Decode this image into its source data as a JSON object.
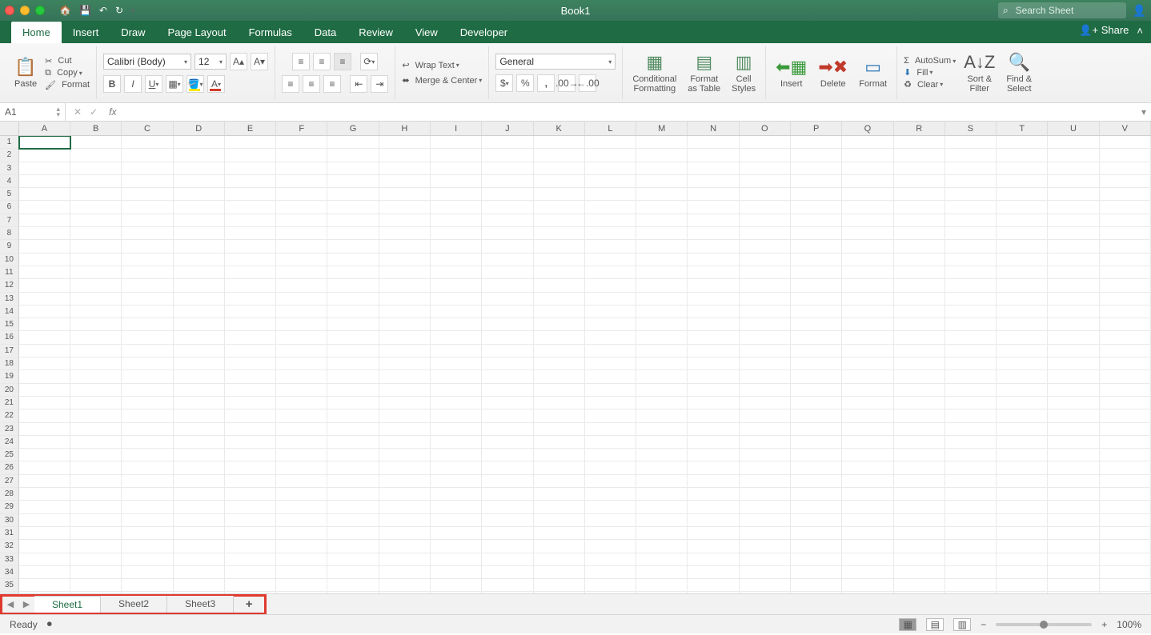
{
  "titlebar": {
    "title": "Book1",
    "search_placeholder": "Search Sheet"
  },
  "tabs": {
    "items": [
      "Home",
      "Insert",
      "Draw",
      "Page Layout",
      "Formulas",
      "Data",
      "Review",
      "View",
      "Developer"
    ],
    "active": "Home",
    "share_label": "Share"
  },
  "ribbon": {
    "paste_label": "Paste",
    "cut_label": "Cut",
    "copy_label": "Copy",
    "format_label": "Format",
    "font_name": "Calibri (Body)",
    "font_size": "12",
    "wrap_label": "Wrap Text",
    "merge_label": "Merge & Center",
    "number_format": "General",
    "cond_fmt_label": "Conditional\nFormatting",
    "table_label": "Format\nas Table",
    "styles_label": "Cell\nStyles",
    "insert_label": "Insert",
    "delete_label": "Delete",
    "formatcell_label": "Format",
    "autosum_label": "AutoSum",
    "fill_label": "Fill",
    "clear_label": "Clear",
    "sort_label": "Sort &\nFilter",
    "find_label": "Find &\nSelect"
  },
  "formula": {
    "namebox": "A1",
    "fx": "fx"
  },
  "grid": {
    "columns": [
      "A",
      "B",
      "C",
      "D",
      "E",
      "F",
      "G",
      "H",
      "I",
      "J",
      "K",
      "L",
      "M",
      "N",
      "O",
      "P",
      "Q",
      "R",
      "S",
      "T",
      "U",
      "V"
    ],
    "rows": 36,
    "active_cell": "A1"
  },
  "sheets": {
    "tabs": [
      "Sheet1",
      "Sheet2",
      "Sheet3"
    ],
    "active": "Sheet1"
  },
  "status": {
    "ready": "Ready",
    "zoom": "100%"
  }
}
